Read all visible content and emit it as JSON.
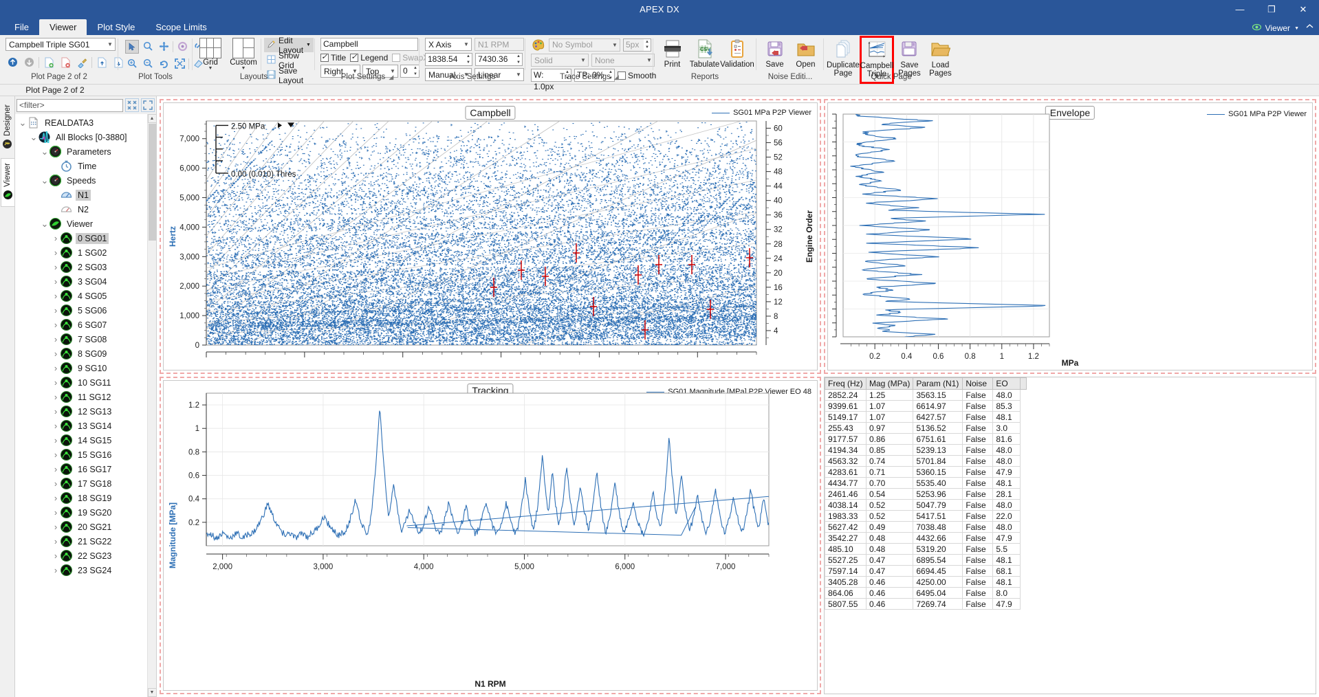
{
  "window": {
    "title": "APEX DX",
    "minimize": "—",
    "maximize": "❐",
    "close": "✕"
  },
  "menu": {
    "tabs": [
      "File",
      "Viewer",
      "Plot Style",
      "Scope Limits"
    ],
    "active": "Viewer",
    "viewer_dropdown": "Viewer",
    "collapse": "^"
  },
  "ribbon": {
    "plot_page": {
      "label": "Plot Page 2 of 2",
      "combo_value": "Campbell Triple SG01",
      "icons": [
        "up-arrow-icon",
        "down-arrow-icon",
        "new-page-icon",
        "delete-page-icon",
        "clear-icon",
        "import-icon",
        "export-icon"
      ]
    },
    "plot_tools": {
      "label": "Plot Tools",
      "row1": [
        "cursor-icon",
        "zoom-icon",
        "pan-icon",
        "settings-icon",
        "link-icon"
      ],
      "row2": [
        "zoom-in-icon",
        "zoom-out-icon",
        "rotate-icon",
        "fit-icon",
        "erase-icon"
      ]
    },
    "layouts": {
      "label": "Layouts",
      "grid_label": "Grid",
      "custom_label": "Custom",
      "edit_layout": "Edit Layout",
      "show_grid": "Show Grid",
      "save_layout": "Save Layout"
    },
    "plot_settings": {
      "label": "Plot Settings",
      "title_value": "Campbell",
      "title_check": "Title",
      "legend_check": "Legend",
      "swapxy_check": "SwapXY",
      "title_checked": true,
      "legend_checked": true,
      "swapxy_checked": false,
      "h_align": "Right",
      "v_align": "Top",
      "offset": "0"
    },
    "axis_settings": {
      "label": "Axis Settings",
      "axis_select": "X Axis",
      "axis_param": "N1 RPM",
      "min": "1838.54",
      "max": "7430.36",
      "scale_mode": "Manual",
      "scale_type": "Linear"
    },
    "trace_settings": {
      "label": "Trace Settings",
      "palette_icon": "palette-icon",
      "symbol": "No Symbol",
      "symbol_size": "5px",
      "line_style": "Solid",
      "fill": "None",
      "width": "W: 1.0px",
      "transparency": "TP: 0%",
      "smooth": "Smooth",
      "smooth_checked": false
    },
    "reports": {
      "label": "Reports",
      "buttons": [
        {
          "caption": "Print",
          "icon": "printer-icon"
        },
        {
          "caption": "Tabulate",
          "icon": "csv-icon"
        },
        {
          "caption": "Validation",
          "icon": "clipboard-icon"
        }
      ]
    },
    "noise_editing": {
      "label": "Noise Editi...",
      "buttons": [
        {
          "caption": "Save",
          "icon": "floppy-icon"
        },
        {
          "caption": "Open",
          "icon": "folder-icon"
        }
      ]
    },
    "quick_page": {
      "label": "Quick Page",
      "buttons": [
        {
          "caption": "Duplicate Page",
          "icon": "duplicate-pages-icon",
          "highlighted": false
        },
        {
          "caption": "Campbell Triple",
          "icon": "campbell-plot-icon",
          "highlighted": true
        },
        {
          "caption": "Save Pages",
          "icon": "floppy-save-icon",
          "highlighted": false
        },
        {
          "caption": "Load Pages",
          "icon": "folder-open-icon",
          "highlighted": false
        }
      ]
    }
  },
  "sidebar": {
    "dock_tabs": [
      {
        "label": "Designer",
        "icon": "designer-icon",
        "active": false
      },
      {
        "label": "Viewer",
        "icon": "viewer-icon",
        "active": true
      }
    ],
    "filter_placeholder": "<filter>",
    "collapse_all_icon": "collapse-all-icon",
    "expand_all_icon": "expand-all-icon",
    "tree": [
      {
        "label": "REALDATA3",
        "depth": 0,
        "expander": "v",
        "icon": "file-icon",
        "selected": false
      },
      {
        "label": "All Blocks [0-3880]",
        "depth": 1,
        "expander": "v",
        "icon": "waveform-icon",
        "selected": false
      },
      {
        "label": "Parameters",
        "depth": 2,
        "expander": "v",
        "icon": "gauge-icon",
        "selected": false
      },
      {
        "label": "Time",
        "depth": 3,
        "expander": "",
        "icon": "clock-icon",
        "selected": false
      },
      {
        "label": "Speeds",
        "depth": 2,
        "expander": "v",
        "icon": "gauge-icon",
        "selected": false
      },
      {
        "label": "N1",
        "depth": 3,
        "expander": "",
        "icon": "speed-icon",
        "selected": true
      },
      {
        "label": "N2",
        "depth": 3,
        "expander": "",
        "icon": "speed-icon-light",
        "selected": false
      },
      {
        "label": "Viewer",
        "depth": 2,
        "expander": "v",
        "icon": "viewer-green-icon",
        "selected": false
      },
      {
        "label": "0 SG01",
        "depth": 3,
        "expander": ">",
        "icon": "sensor-icon",
        "selected": true
      },
      {
        "label": "1 SG02",
        "depth": 3,
        "expander": ">",
        "icon": "sensor-icon",
        "selected": false
      },
      {
        "label": "2 SG03",
        "depth": 3,
        "expander": ">",
        "icon": "sensor-icon",
        "selected": false
      },
      {
        "label": "3 SG04",
        "depth": 3,
        "expander": ">",
        "icon": "sensor-icon",
        "selected": false
      },
      {
        "label": "4 SG05",
        "depth": 3,
        "expander": ">",
        "icon": "sensor-icon",
        "selected": false
      },
      {
        "label": "5 SG06",
        "depth": 3,
        "expander": ">",
        "icon": "sensor-icon",
        "selected": false
      },
      {
        "label": "6 SG07",
        "depth": 3,
        "expander": ">",
        "icon": "sensor-icon",
        "selected": false
      },
      {
        "label": "7 SG08",
        "depth": 3,
        "expander": ">",
        "icon": "sensor-icon",
        "selected": false
      },
      {
        "label": "8 SG09",
        "depth": 3,
        "expander": ">",
        "icon": "sensor-icon",
        "selected": false
      },
      {
        "label": "9 SG10",
        "depth": 3,
        "expander": ">",
        "icon": "sensor-icon",
        "selected": false
      },
      {
        "label": "10 SG11",
        "depth": 3,
        "expander": ">",
        "icon": "sensor-icon",
        "selected": false
      },
      {
        "label": "11 SG12",
        "depth": 3,
        "expander": ">",
        "icon": "sensor-icon",
        "selected": false
      },
      {
        "label": "12 SG13",
        "depth": 3,
        "expander": ">",
        "icon": "sensor-icon",
        "selected": false
      },
      {
        "label": "13 SG14",
        "depth": 3,
        "expander": ">",
        "icon": "sensor-icon",
        "selected": false
      },
      {
        "label": "14 SG15",
        "depth": 3,
        "expander": ">",
        "icon": "sensor-icon",
        "selected": false
      },
      {
        "label": "15 SG16",
        "depth": 3,
        "expander": ">",
        "icon": "sensor-icon",
        "selected": false
      },
      {
        "label": "16 SG17",
        "depth": 3,
        "expander": ">",
        "icon": "sensor-icon",
        "selected": false
      },
      {
        "label": "17 SG18",
        "depth": 3,
        "expander": ">",
        "icon": "sensor-icon",
        "selected": false
      },
      {
        "label": "18 SG19",
        "depth": 3,
        "expander": ">",
        "icon": "sensor-icon",
        "selected": false
      },
      {
        "label": "19 SG20",
        "depth": 3,
        "expander": ">",
        "icon": "sensor-icon",
        "selected": false
      },
      {
        "label": "20 SG21",
        "depth": 3,
        "expander": ">",
        "icon": "sensor-icon",
        "selected": false
      },
      {
        "label": "21 SG22",
        "depth": 3,
        "expander": ">",
        "icon": "sensor-icon",
        "selected": false
      },
      {
        "label": "22 SG23",
        "depth": 3,
        "expander": ">",
        "icon": "sensor-icon",
        "selected": false
      },
      {
        "label": "23 SG24",
        "depth": 3,
        "expander": ">",
        "icon": "sensor-icon",
        "selected": false
      }
    ]
  },
  "chart_data": [
    {
      "id": "campbell",
      "type": "scatter",
      "title": "Campbell",
      "xlabel": "",
      "ylabel": "Hertz",
      "y2label": "Engine Order",
      "xlim": [
        1838.54,
        7430.36
      ],
      "ylim": [
        0,
        7600
      ],
      "y2lim": [
        0,
        62
      ],
      "yticks": [
        0,
        1000,
        2000,
        3000,
        4000,
        5000,
        6000,
        7000
      ],
      "yticklabels": [
        "0",
        "1,000",
        "2,000",
        "3,000",
        "4,000",
        "5,000",
        "6,000",
        "7,000"
      ],
      "y2ticks": [
        4,
        8,
        12,
        16,
        20,
        24,
        28,
        32,
        36,
        40,
        44,
        48,
        52,
        56,
        60
      ],
      "y2ticklabels": [
        "4",
        "8",
        "12",
        "16",
        "20",
        "24",
        "28",
        "32",
        "36",
        "40",
        "44",
        "48",
        "52",
        "56",
        "60"
      ],
      "legend": [
        "SG01 MPa P2P Viewer"
      ],
      "legend_position": "top-right",
      "annotations": [
        {
          "text": "2.50 MPa",
          "role": "scale-max-marker"
        },
        {
          "text": "0.00  (0.010) Thres",
          "role": "threshold-marker"
        }
      ],
      "grid": false,
      "series_color": "#2d6fb5",
      "order_line_color": "#b0b0b0",
      "marker_color": "#cc0000",
      "description": "Dense blue scatter of spectral peaks vs N1 RPM with grey engine-order ray lines and red vertical cursor markers"
    },
    {
      "id": "envelope",
      "type": "line",
      "title": "Envelope",
      "xlabel": "MPa",
      "ylabel": "",
      "xlim": [
        0,
        1.3
      ],
      "xticks": [
        0.2,
        0.4,
        0.6,
        0.8,
        1.0,
        1.2
      ],
      "xticklabels": [
        "0.2",
        "0.4",
        "0.6",
        "0.8",
        "1",
        "1.2"
      ],
      "legend": [
        "SG01 MPa P2P Viewer"
      ],
      "legend_position": "top-right",
      "grid": true,
      "series_color": "#2d6fb5",
      "description": "Horizontal envelope profile of peak-to-peak MPa vs frequency (vertical axis)"
    },
    {
      "id": "tracking",
      "type": "line",
      "title": "Tracking",
      "xlabel": "N1 RPM",
      "ylabel": "Magnitude [MPa]",
      "xlim": [
        1838.54,
        7430.36
      ],
      "ylim": [
        0,
        1.3
      ],
      "xticks": [
        2000,
        3000,
        4000,
        5000,
        6000,
        7000
      ],
      "xticklabels": [
        "2,000",
        "3,000",
        "4,000",
        "5,000",
        "6,000",
        "7,000"
      ],
      "yticks": [
        0.2,
        0.4,
        0.6,
        0.8,
        1.0,
        1.2
      ],
      "yticklabels": [
        "0.2",
        "0.4",
        "0.6",
        "0.8",
        "1",
        "1.2"
      ],
      "legend": [
        "SG01 Magnitude [MPa] P2P Viewer EO 48"
      ],
      "legend_position": "top-right",
      "grid": true,
      "series_color": "#2d6fb5",
      "description": "Order-tracked magnitude vs N1 RPM, peak ~1.25 MPa near 3560 RPM"
    }
  ],
  "table": {
    "headers": [
      "Freq (Hz)",
      "Mag (MPa)",
      "Param (N1)",
      "Noise",
      "EO"
    ],
    "rows": [
      [
        "2852.24",
        "1.25",
        "3563.15",
        "False",
        "48.0"
      ],
      [
        "9399.61",
        "1.07",
        "6614.97",
        "False",
        "85.3"
      ],
      [
        "5149.17",
        "1.07",
        "6427.57",
        "False",
        "48.1"
      ],
      [
        "255.43",
        "0.97",
        "5136.52",
        "False",
        "3.0"
      ],
      [
        "9177.57",
        "0.86",
        "6751.61",
        "False",
        "81.6"
      ],
      [
        "4194.34",
        "0.85",
        "5239.13",
        "False",
        "48.0"
      ],
      [
        "4563.32",
        "0.74",
        "5701.84",
        "False",
        "48.0"
      ],
      [
        "4283.61",
        "0.71",
        "5360.15",
        "False",
        "47.9"
      ],
      [
        "4434.77",
        "0.70",
        "5535.40",
        "False",
        "48.1"
      ],
      [
        "2461.46",
        "0.54",
        "5253.96",
        "False",
        "28.1"
      ],
      [
        "4038.14",
        "0.52",
        "5047.79",
        "False",
        "48.0"
      ],
      [
        "1983.33",
        "0.52",
        "5417.51",
        "False",
        "22.0"
      ],
      [
        "5627.42",
        "0.49",
        "7038.48",
        "False",
        "48.0"
      ],
      [
        "3542.27",
        "0.48",
        "4432.66",
        "False",
        "47.9"
      ],
      [
        "485.10",
        "0.48",
        "5319.20",
        "False",
        "5.5"
      ],
      [
        "5527.25",
        "0.47",
        "6895.54",
        "False",
        "48.1"
      ],
      [
        "7597.14",
        "0.47",
        "6694.45",
        "False",
        "68.1"
      ],
      [
        "3405.28",
        "0.46",
        "4250.00",
        "False",
        "48.1"
      ],
      [
        "864.06",
        "0.46",
        "6495.04",
        "False",
        "8.0"
      ],
      [
        "5807.55",
        "0.46",
        "7269.74",
        "False",
        "47.9"
      ]
    ]
  },
  "colors": {
    "titlebar": "#2a5699",
    "accent": "#2d6fb5",
    "highlight": "#ff0000",
    "selection_dash": "#f0a8a8",
    "ribbon_bg": "#f0f0f0"
  }
}
